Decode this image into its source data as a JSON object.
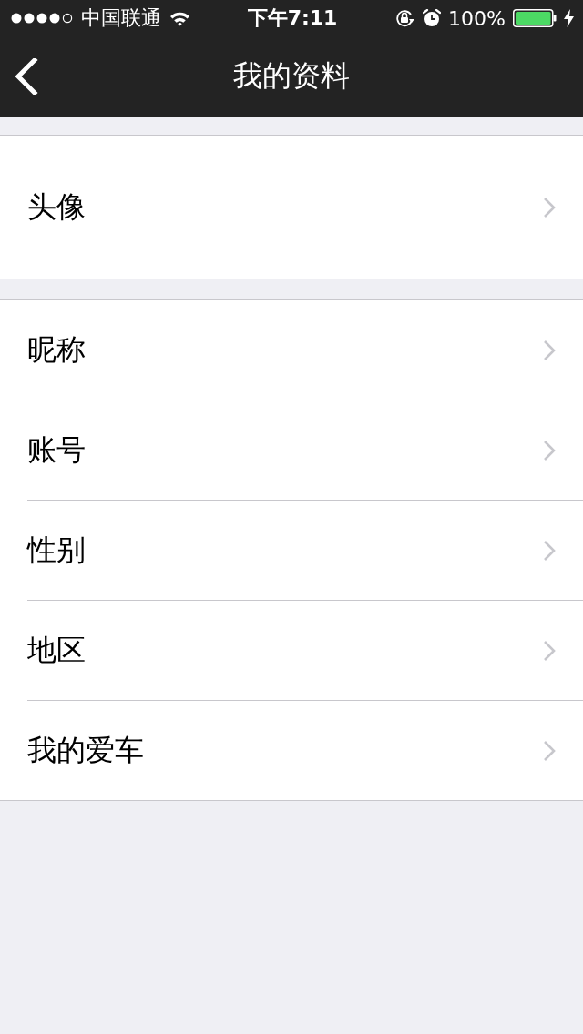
{
  "status_bar": {
    "carrier": "中国联通",
    "time": "下午7:11",
    "battery": "100%"
  },
  "nav_bar": {
    "title": "我的资料"
  },
  "sections": [
    {
      "items": [
        {
          "label": "头像"
        }
      ]
    },
    {
      "items": [
        {
          "label": "昵称"
        },
        {
          "label": "账号"
        },
        {
          "label": "性别"
        },
        {
          "label": "地区"
        },
        {
          "label": "我的爱车"
        }
      ]
    }
  ]
}
